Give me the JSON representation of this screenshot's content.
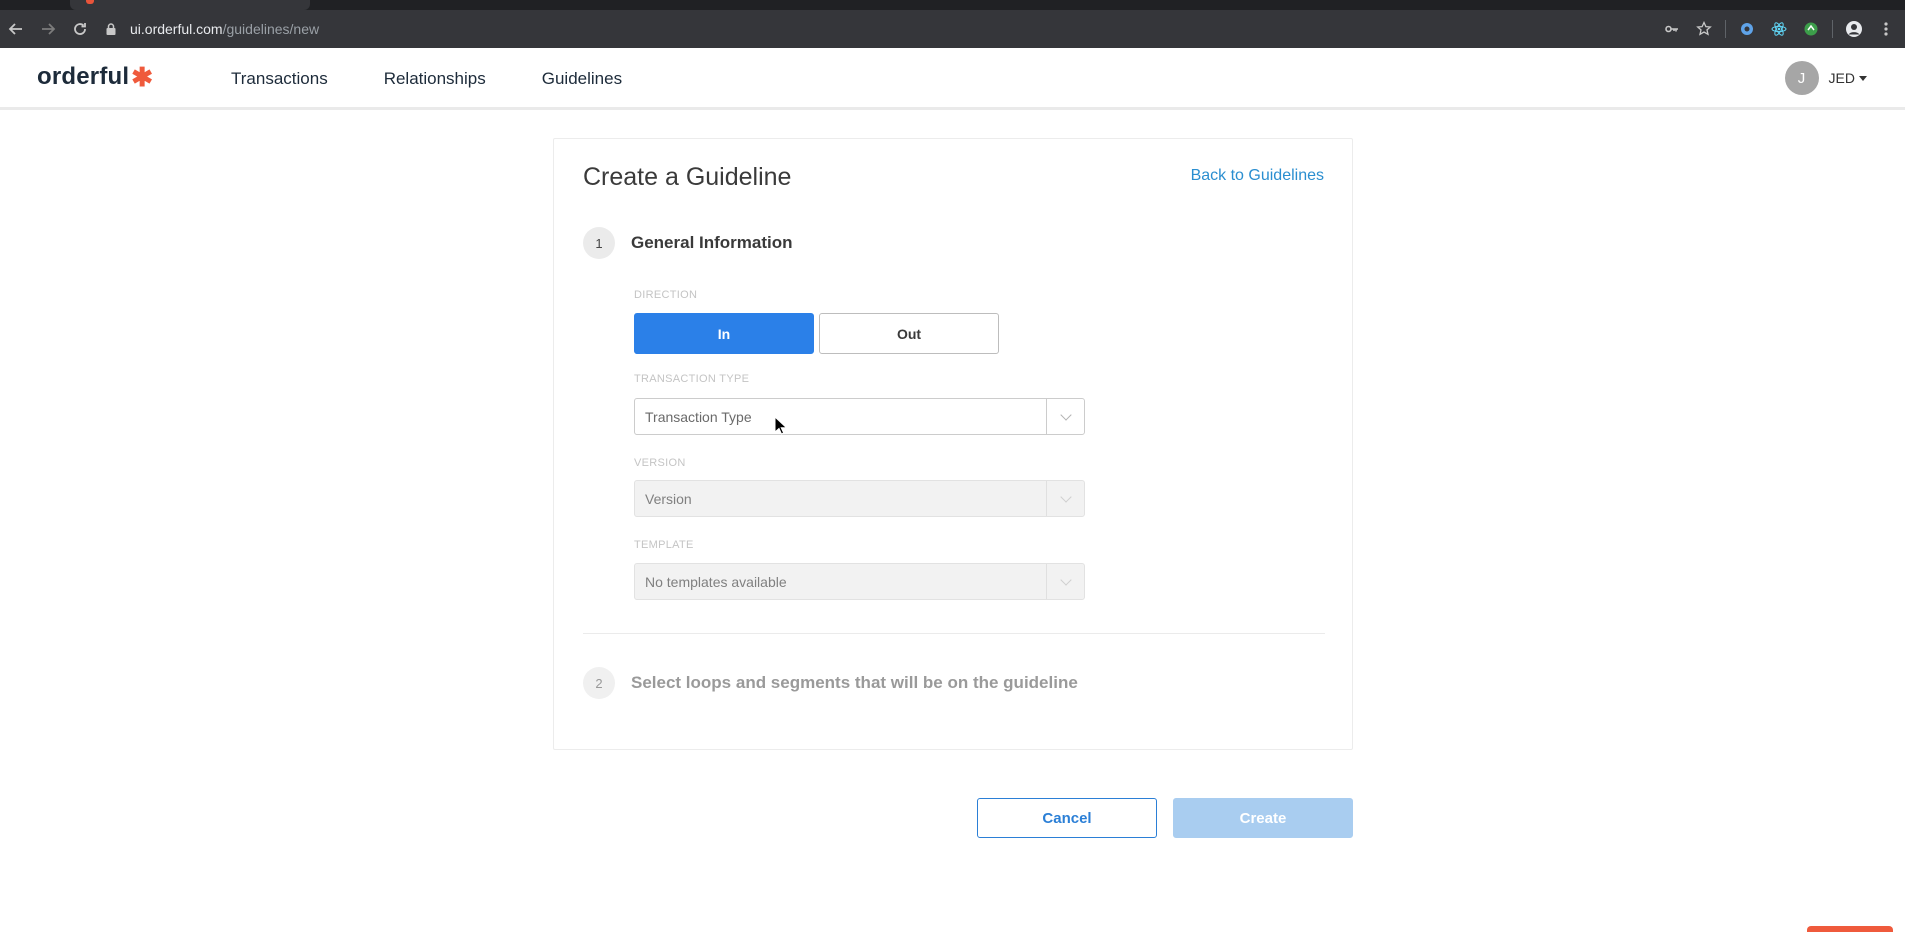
{
  "browser": {
    "url_host": "ui.orderful.com",
    "url_path": "/guidelines/new",
    "icons": [
      "back-icon",
      "forward-icon",
      "reload-icon",
      "lock-icon",
      "key-icon",
      "star-icon",
      "extension-icon",
      "react-icon",
      "extension-icon",
      "account-icon",
      "menu-icon"
    ]
  },
  "header": {
    "logo_text": "orderful",
    "logo_mark": "✱",
    "nav": [
      "Transactions",
      "Relationships",
      "Guidelines"
    ],
    "user": {
      "avatar_initial": "J",
      "name": "JED"
    }
  },
  "form": {
    "title": "Create a Guideline",
    "back_link": "Back to Guidelines",
    "steps": [
      {
        "number": "1",
        "label": "General Information"
      },
      {
        "number": "2",
        "label": "Select loops and segments that will be on the guideline"
      }
    ],
    "direction": {
      "label": "DIRECTION",
      "options": [
        "In",
        "Out"
      ],
      "selected": "In"
    },
    "transaction_type": {
      "label": "TRANSACTION TYPE",
      "placeholder": "Transaction Type"
    },
    "version": {
      "label": "VERSION",
      "placeholder": "Version"
    },
    "template": {
      "label": "TEMPLATE",
      "placeholder": "No templates available"
    }
  },
  "actions": {
    "cancel": "Cancel",
    "create": "Create"
  },
  "colors": {
    "accent": "#2b80e8",
    "brand_mark": "#ef5a3c",
    "link": "#2a8ed0",
    "create_disabled": "#a9cdf0"
  }
}
